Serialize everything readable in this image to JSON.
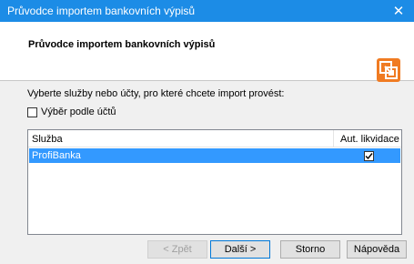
{
  "window": {
    "title": "Průvodce importem bankovních výpisů",
    "close_glyph": "✕"
  },
  "header": {
    "title": "Průvodce importem bankovních výpisů",
    "logo_icon": "import-wizard-icon"
  },
  "content": {
    "prompt": "Vyberte služby nebo účty, pro které chcete import provést:",
    "checkbox_label": "Výběr podle účtů",
    "checkbox_checked": false,
    "table": {
      "columns": [
        "Služba",
        "Aut. likvidace"
      ],
      "rows": [
        {
          "service": "ProfiBanka",
          "auto_liquidation": true,
          "selected": true
        }
      ]
    }
  },
  "buttons": {
    "back": "< Zpět",
    "next": "Další >",
    "cancel": "Storno",
    "help": "Nápověda"
  },
  "colors": {
    "titlebar": "#1c8ce6",
    "selection": "#3399ff",
    "logo_orange": "#f07b22"
  }
}
